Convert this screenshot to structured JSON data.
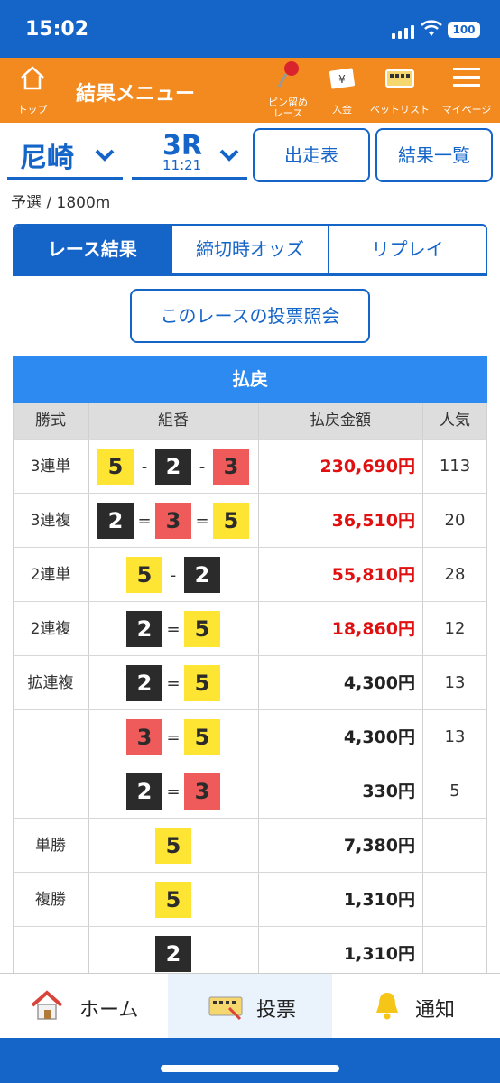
{
  "status": {
    "time": "15:02",
    "battery": "100"
  },
  "header": {
    "top_label": "トップ",
    "title": "結果メニュー",
    "pin_label1": "ピン留め",
    "pin_label2": "レース",
    "deposit_label": "入金",
    "betlist_label": "ベットリスト",
    "mypage_label": "マイページ"
  },
  "race": {
    "venue": "尼崎",
    "race_no": "3R",
    "time": "11:21",
    "entries_button": "出走表",
    "results_button": "結果一覧",
    "info": "予選 / 1800m"
  },
  "tabs": [
    "レース結果",
    "締切時オッズ",
    "リプレイ"
  ],
  "inquiry_button": "このレースの投票照会",
  "payout": {
    "title": "払戻",
    "headers": [
      "勝式",
      "組番",
      "払戻金額",
      "人気"
    ],
    "rows": [
      {
        "type": "3連単",
        "nums": [
          "5",
          "2",
          "3"
        ],
        "sep": "-",
        "amount": "230,690円",
        "pop": "113",
        "highlight": true
      },
      {
        "type": "3連複",
        "nums": [
          "2",
          "3",
          "5"
        ],
        "sep": "=",
        "amount": "36,510円",
        "pop": "20",
        "highlight": true
      },
      {
        "type": "2連単",
        "nums": [
          "5",
          "2"
        ],
        "sep": "-",
        "amount": "55,810円",
        "pop": "28",
        "highlight": true
      },
      {
        "type": "2連複",
        "nums": [
          "2",
          "5"
        ],
        "sep": "=",
        "amount": "18,860円",
        "pop": "12",
        "highlight": true
      },
      {
        "type": "拡連複",
        "nums": [
          "2",
          "5"
        ],
        "sep": "=",
        "amount": "4,300円",
        "pop": "13",
        "highlight": false
      },
      {
        "type": "",
        "nums": [
          "3",
          "5"
        ],
        "sep": "=",
        "amount": "4,300円",
        "pop": "13",
        "highlight": false
      },
      {
        "type": "",
        "nums": [
          "2",
          "3"
        ],
        "sep": "=",
        "amount": "330円",
        "pop": "5",
        "highlight": false
      },
      {
        "type": "単勝",
        "nums": [
          "5"
        ],
        "sep": "",
        "amount": "7,380円",
        "pop": "",
        "highlight": false
      },
      {
        "type": "複勝",
        "nums": [
          "5"
        ],
        "sep": "",
        "amount": "1,310円",
        "pop": "",
        "highlight": false
      },
      {
        "type": "",
        "nums": [
          "2"
        ],
        "sep": "",
        "amount": "1,310円",
        "pop": "",
        "highlight": false
      }
    ]
  },
  "num_colors": {
    "2": {
      "bg": "#2b2b2b",
      "fg": "#ffffff"
    },
    "3": {
      "bg": "#ef5a5a",
      "fg": "#2b2b2b"
    },
    "5": {
      "bg": "#ffe533",
      "fg": "#2b2b2b"
    }
  },
  "bottom_nav": {
    "home": "ホーム",
    "vote": "投票",
    "notify": "通知"
  },
  "colors": {
    "primary": "#1565c9",
    "header": "#f28a1f",
    "table_title": "#2d8af0",
    "payout_red": "#e01010"
  }
}
